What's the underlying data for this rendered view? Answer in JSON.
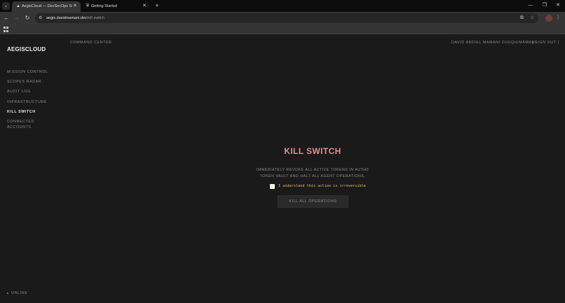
{
  "browser": {
    "tabs": [
      {
        "title": "AegisCloud — DevSecOps Sen",
        "active": true
      },
      {
        "title": "Getting Started",
        "active": false
      }
    ],
    "url_host": "aegis.davidmamani.dev",
    "url_path": "/kill-switch"
  },
  "icons": {
    "tab_search": "⌄",
    "tab_fav_active": "▲",
    "tab_fav_inactive": "⛨",
    "tab_close": "✕",
    "new_tab": "+",
    "minimize": "—",
    "restore": "❐",
    "close": "✕",
    "back": "←",
    "forward": "→",
    "reload": "↻",
    "site_info": "⚙",
    "translate": "⧉",
    "bookmark_star": "☆",
    "menu": "⋮"
  },
  "sidebar": {
    "brand": "AEGISCLOUD",
    "items": [
      {
        "label": "MISSION CONTROL",
        "active": false
      },
      {
        "label": "SCOPES RADAR",
        "active": false
      },
      {
        "label": "AUDIT LOG",
        "active": false
      },
      {
        "label": "INFRASTRUCTURE",
        "active": false
      },
      {
        "label": "KILL SWITCH",
        "active": true
      },
      {
        "label": "CONNECTED ACCOUNTS",
        "active": false
      }
    ],
    "status": "ONLINE"
  },
  "header": {
    "section": "COMMAND CENTER",
    "user": "DAVID ABDIEL MAMANI CHUQUIMAMANI",
    "sign_out": "[ SIGN OUT ]"
  },
  "kill_switch": {
    "title": "KILL SWITCH",
    "description_line1": "IMMEDIATELY REVOKE ALL ACTIVE TOKENS IN AUTH0",
    "description_line2": "TOKEN VAULT AND HALT ALL AGENT OPERATIONS.",
    "confirm_label": "I understand this action is irreversible",
    "button": "KILL ALL OPERATIONS"
  },
  "colors": {
    "background": "#1a1a1a",
    "title": "#e58c8c",
    "warning_text": "#e3bd55",
    "muted": "#8a8a8a"
  }
}
